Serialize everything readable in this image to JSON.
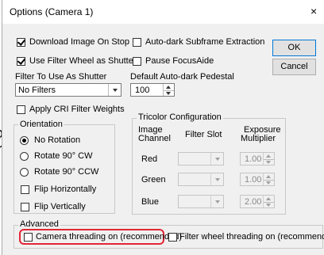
{
  "window": {
    "title": "Options (Camera 1)",
    "close_glyph": "×"
  },
  "background_fragments": {
    "partial_char_1": "o",
    "partial_char_2": "r"
  },
  "buttons": {
    "ok": "OK",
    "cancel": "Cancel"
  },
  "top_checks": {
    "download_image_on_stop": {
      "label": "Download Image On Stop",
      "checked": true
    },
    "auto_dark_subframe": {
      "label": "Auto-dark Subframe Extraction",
      "checked": false
    },
    "use_filter_wheel": {
      "label": "Use Filter Wheel as Shutter",
      "checked": true
    },
    "pause_focusaide": {
      "label": "Pause FocusAide",
      "checked": false
    }
  },
  "filter_shutter": {
    "label": "Filter To Use As Shutter",
    "value": "No Filters"
  },
  "pedestal": {
    "label": "Default Auto-dark Pedestal",
    "value": "100"
  },
  "apply_cri": {
    "label": "Apply CRI Filter Weights",
    "checked": false
  },
  "orientation": {
    "title": "Orientation",
    "options": [
      {
        "label": "No Rotation",
        "selected": true
      },
      {
        "label": "Rotate 90° CW",
        "selected": false
      },
      {
        "label": "Rotate 90° CCW",
        "selected": false
      }
    ],
    "flip_h": {
      "label": "Flip Horizontally",
      "checked": false
    },
    "flip_v": {
      "label": "Flip Vertically",
      "checked": false
    }
  },
  "tricolor": {
    "title": "Tricolor Configuration",
    "headers": {
      "image_channel_1": "Image",
      "image_channel_2": "Channel",
      "filter_slot": "Filter Slot",
      "exposure_1": "Exposure",
      "exposure_2": "Multiplier"
    },
    "rows": [
      {
        "channel": "Red",
        "filter": "",
        "multiplier": "1.00"
      },
      {
        "channel": "Green",
        "filter": "",
        "multiplier": "1.00"
      },
      {
        "channel": "Blue",
        "filter": "",
        "multiplier": "2.00"
      }
    ]
  },
  "advanced": {
    "title": "Advanced",
    "camera_threading": {
      "label": "Camera threading on (recommended)",
      "checked": false
    },
    "filter_threading": {
      "label": "Filter wheel threading on (recommended)",
      "checked": false
    }
  },
  "colors": {
    "highlight": "#e32636",
    "dialog_bg": "#f0f0f0",
    "default_button_border": "#0078d7"
  }
}
